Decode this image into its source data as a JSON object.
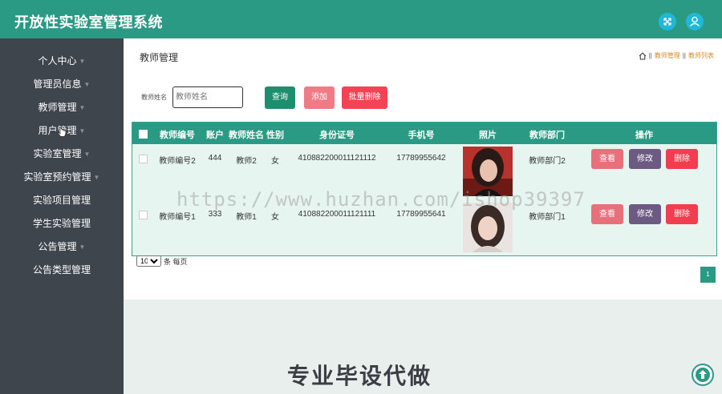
{
  "app": {
    "title": "开放性实验室管理系统"
  },
  "header_icons": [
    "fullscreen-icon",
    "user-icon"
  ],
  "sidebar": {
    "items": [
      {
        "label": "个人中心",
        "has_submenu": true
      },
      {
        "label": "管理员信息",
        "has_submenu": true
      },
      {
        "label": "教师管理",
        "has_submenu": true
      },
      {
        "label": "用户管理",
        "has_submenu": true
      },
      {
        "label": "实验室管理",
        "has_submenu": true
      },
      {
        "label": "实验室预约管理",
        "has_submenu": true
      },
      {
        "label": "实验项目管理",
        "has_submenu": false
      },
      {
        "label": "学生实验管理",
        "has_submenu": false
      },
      {
        "label": "公告管理",
        "has_submenu": true
      },
      {
        "label": "公告类型管理",
        "has_submenu": false
      }
    ]
  },
  "page": {
    "title": "教师管理",
    "breadcrumb": {
      "sep": "||",
      "items": [
        "教师管理",
        "教师列表"
      ]
    }
  },
  "search": {
    "label": "教师姓名",
    "placeholder": "教师姓名",
    "query_label": "查询",
    "add_label": "添加",
    "batch_delete_label": "批量删除"
  },
  "table": {
    "columns": [
      "教师编号",
      "账户",
      "教师姓名",
      "性别",
      "身份证号",
      "手机号",
      "照片",
      "教师部门",
      "操作"
    ],
    "rows": [
      {
        "id": "教师编号2",
        "account": "444",
        "name": "教师2",
        "gender": "女",
        "id_card": "410882200011121112",
        "phone": "17789955642",
        "department": "教师部门2"
      },
      {
        "id": "教师编号1",
        "account": "333",
        "name": "教师1",
        "gender": "女",
        "id_card": "410882200011121111",
        "phone": "17789955641",
        "department": "教师部门1"
      }
    ],
    "actions": {
      "view": "查看",
      "edit": "修改",
      "delete": "删除"
    }
  },
  "pagination": {
    "page_size": "10",
    "page_size_suffix": "条 每页",
    "current_page": "1"
  },
  "overlay": {
    "watermark": "https://www.huzhan.com/ishop39397",
    "promo": "专业毕设代做"
  },
  "colors": {
    "primary": "#2b9a84",
    "sidebar": "#3f454d",
    "query_button": "#1e8e6e",
    "add_button": "#f07b86",
    "batch_delete_button": "#f44355",
    "view_button": "#e8707b",
    "edit_button": "#6d5a82",
    "delete_button": "#f23d4f"
  }
}
